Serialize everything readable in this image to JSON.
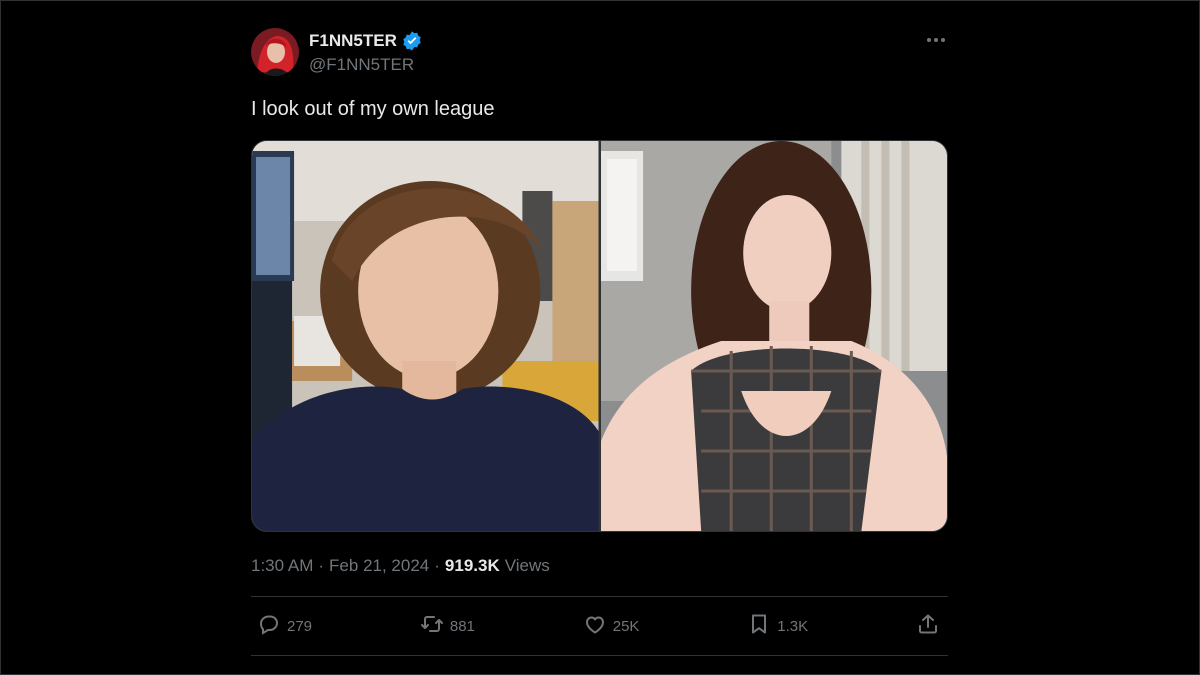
{
  "author": {
    "display_name": "F1NN5TER",
    "handle": "@F1NN5TER",
    "verified": true,
    "avatar_icon": "profile-avatar"
  },
  "tweet": {
    "text": "I look out of my own league",
    "time": "1:30 AM",
    "date": "Feb 21, 2024",
    "separator": "·",
    "views_count": "919.3K",
    "views_label": "Views"
  },
  "media": {
    "count": 2,
    "items": [
      {
        "name": "photo-left"
      },
      {
        "name": "photo-right"
      }
    ]
  },
  "actions": {
    "replies": {
      "icon": "reply-icon",
      "count": "279"
    },
    "reposts": {
      "icon": "repost-icon",
      "count": "881"
    },
    "likes": {
      "icon": "like-icon",
      "count": "25K"
    },
    "bookmarks": {
      "icon": "bookmark-icon",
      "count": "1.3K"
    },
    "share": {
      "icon": "share-icon"
    }
  },
  "colors": {
    "background": "#000000",
    "text": "#e7e9ea",
    "muted": "#71767b",
    "verified": "#1d9bf0",
    "border": "#2f3336"
  }
}
